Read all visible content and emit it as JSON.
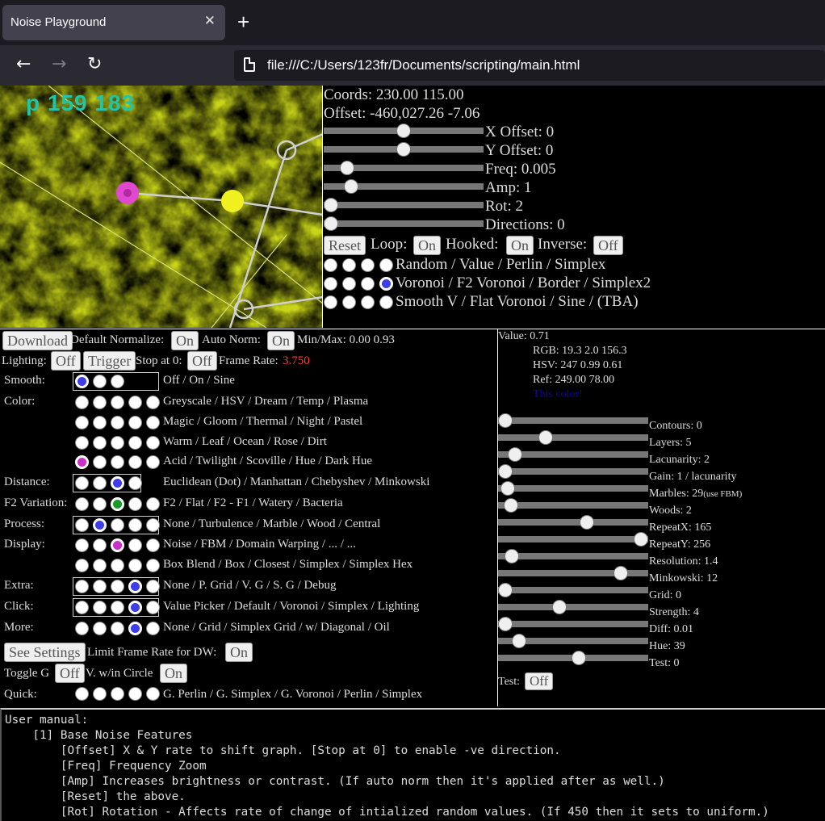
{
  "browser": {
    "tab_title": "Noise Playground",
    "tab_close": "✕",
    "new_tab": "+",
    "back": "←",
    "forward": "→",
    "reload": "↻",
    "url": "file:///C:/Users/123fr/Documents/scripting/main.html"
  },
  "canvas": {
    "overlay_label": "p 159 183"
  },
  "top_panel": {
    "coords": "Coords: 230.00 115.00",
    "offset": "Offset: -460,027.26 -7.06",
    "sliders": [
      {
        "label": "X Offset: 0",
        "level": 0.5
      },
      {
        "label": "Y Offset: 0",
        "level": 0.5
      },
      {
        "label": "Freq: 0.005",
        "level": 0.11
      },
      {
        "label": "Amp: 1",
        "level": 0.14
      },
      {
        "label": "Rot: 2",
        "level": 0.0
      },
      {
        "label": "Directions: 0",
        "level": 0.0
      }
    ],
    "reset": "Reset",
    "loop_label": "Loop:",
    "loop_value": "On",
    "hooked_label": "Hooked:",
    "hooked_value": "On",
    "inverse_label": "Inverse:",
    "inverse_value": "Off",
    "noise_rows": [
      {
        "text": "Random / Value / Perlin / Simplex",
        "selected": -1
      },
      {
        "text": "Voronoi / F2 Voronoi / Border / Simplex2",
        "selected": 3
      },
      {
        "text": "Smooth V / Flat Voronoi / Sine / (TBA)",
        "selected": -1
      }
    ],
    "radio_selected_color": "#3e3ee8"
  },
  "left_panel": {
    "download": "Download",
    "default_normalize_label": "Default Normalize:",
    "default_normalize_value": "On",
    "auto_norm_label": "Auto Norm:",
    "auto_norm_value": "On",
    "minmax": "Min/Max: 0.00 0.93",
    "lighting_label": "Lighting:",
    "lighting_value": "Off",
    "trigger": "Trigger",
    "stop_label": "Stop at 0:",
    "stop_value": "Off",
    "frame_rate_label": "Frame Rate:",
    "frame_rate_value": "3.750",
    "frame_rate_color": "#ff3b2f",
    "rows": [
      {
        "label": "Smooth:",
        "count": 3,
        "selected": 0,
        "color": "#3e3ee8",
        "boxed": true,
        "text": "Off / On / Sine"
      },
      {
        "label": "Color:",
        "count": 5,
        "selected": -1,
        "color": "",
        "boxed": false,
        "text": "Greyscale / HSV / Dream / Temp / Plasma"
      },
      {
        "label": "",
        "count": 5,
        "selected": -1,
        "color": "",
        "boxed": false,
        "text": "Magic / Gloom / Thermal / Night / Pastel"
      },
      {
        "label": "",
        "count": 5,
        "selected": -1,
        "color": "",
        "boxed": false,
        "text": "Warm / Leaf / Ocean / Rose / Dirt"
      },
      {
        "label": "",
        "count": 5,
        "selected": 0,
        "color": "#c930c9",
        "boxed": false,
        "text": "Acid / Twilight / Scoville / Hue / Dark Hue"
      },
      {
        "label": "Distance:",
        "count": 4,
        "selected": 2,
        "color": "#3e3ee8",
        "boxed": true,
        "text": "Euclidean (Dot) / Manhattan / Chebyshev / Minkowski"
      },
      {
        "label": "F2 Variation:",
        "count": 5,
        "selected": 2,
        "color": "#1a9a2a",
        "boxed": false,
        "text": "F2 / Flat / F2 - F1 / Watery / Bacteria"
      },
      {
        "label": "Process:",
        "count": 5,
        "selected": 1,
        "color": "#3e3ee8",
        "boxed": true,
        "text": "None / Turbulence / Marble / Wood / Central"
      },
      {
        "label": "Display:",
        "count": 5,
        "selected": 2,
        "color": "#c930c9",
        "boxed": false,
        "text": "Noise / FBM / Domain Warping / ... / ..."
      },
      {
        "label": "",
        "count": 5,
        "selected": -1,
        "color": "",
        "boxed": false,
        "text": "Box Blend / Box / Closest / Simplex / Simplex Hex"
      },
      {
        "label": "Extra:",
        "count": 5,
        "selected": 3,
        "color": "#3e3ee8",
        "boxed": true,
        "text": "None / P. Grid / V. G / S. G / Debug"
      },
      {
        "label": "Click:",
        "count": 5,
        "selected": 3,
        "color": "#3e3ee8",
        "boxed": true,
        "text": "Value Picker / Default / Voronoi / Simplex / Lighting"
      },
      {
        "label": "More:",
        "count": 5,
        "selected": 3,
        "color": "#3e3ee8",
        "boxed": false,
        "text": "None / Grid / Simplex Grid / w/ Diagonal / Oil"
      }
    ],
    "see_settings": "See Settings",
    "limit_label": "Limit Frame Rate for DW:",
    "limit_value": "On",
    "toggle_g_label": "Toggle G",
    "toggle_g_value": "Off",
    "vwin_label": "V. w/in Circle",
    "vwin_value": "On",
    "quick_label": "Quick:",
    "quick_text": "G. Perlin / G. Simplex / G. Voronoi / Perlin / Simplex"
  },
  "right_panel": {
    "value": "Value: 0.71",
    "rgb": "RGB: 19.3 2.0 156.3",
    "hsv": "HSV: 247 0.99 0.61",
    "ref": "Ref: 249.00 78.00",
    "this_color": "This color!",
    "this_color_hex": "#10029c",
    "sliders": [
      {
        "label": "Contours: 0",
        "level": 0.0
      },
      {
        "label": "Layers: 5",
        "level": 0.3
      },
      {
        "label": "Lacunarity: 2",
        "level": 0.07
      },
      {
        "label": "Gain: 1 / lacunarity",
        "level": 0.0
      },
      {
        "label": "Marbles: 29",
        "extra": "(use FBM)",
        "level": 0.02
      },
      {
        "label": "Woods: 2",
        "level": 0.04
      },
      {
        "label": "RepeatX: 165",
        "level": 0.6
      },
      {
        "label": "RepeatY: 256",
        "level": 1.0
      },
      {
        "label": "Resolution: 1.4",
        "level": 0.05
      },
      {
        "label": "Minkowski: 12",
        "level": 0.85
      },
      {
        "label": "Grid: 0",
        "level": 0.0
      },
      {
        "label": "Strength: 4",
        "level": 0.4
      },
      {
        "label": "Diff: 0.01",
        "level": 0.0
      },
      {
        "label": "Hue: 39",
        "level": 0.1
      },
      {
        "label": "Test: 0",
        "level": 0.54
      }
    ],
    "test_label": "Test:",
    "test_value": "Off"
  },
  "manual": {
    "lines": [
      "User manual:",
      "    [1] Base Noise Features",
      "        [Offset] X & Y rate to shift graph. [Stop at 0] to enable -ve direction.",
      "        [Freq] Frequency Zoom",
      "        [Amp] Increases brightness or contrast. (If auto norm then it's applied after as well.)",
      "        [Reset] the above.",
      "        [Rot] Rotation - Affects rate of change of intialized random values. (If 450 then it sets to uniform.)"
    ]
  }
}
